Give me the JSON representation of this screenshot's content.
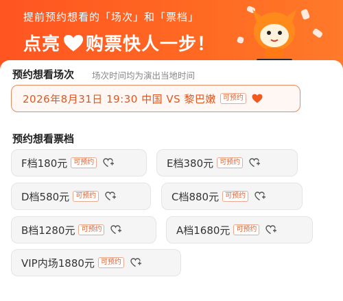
{
  "banner": {
    "subtitle": "提前预约想看的「场次」和「票档」",
    "headline_left": "点亮",
    "headline_right": "购票快人一步！"
  },
  "session_section": {
    "title": "预约想看场次",
    "note": "场次时间均为演出当地时间",
    "session": {
      "text": "2026年8月31日 19:30 中国 VS 黎巴嫩",
      "tag": "可预约"
    }
  },
  "tier_section": {
    "title": "预约想看票档",
    "tiers": [
      {
        "name": "F档180元",
        "tag": "可预约"
      },
      {
        "name": "E档380元",
        "tag": "可预约"
      },
      {
        "name": "D档580元",
        "tag": "可预约"
      },
      {
        "name": "C档880元",
        "tag": "可预约"
      },
      {
        "name": "B档1280元",
        "tag": "可预约"
      },
      {
        "name": "A档1680元",
        "tag": "可预约"
      },
      {
        "name": "VIP内场1880元",
        "tag": "可预约"
      }
    ]
  },
  "colors": {
    "brand": "#ff5a1f",
    "accent_text": "#e0561f",
    "tag_border": "#e9a98f"
  }
}
